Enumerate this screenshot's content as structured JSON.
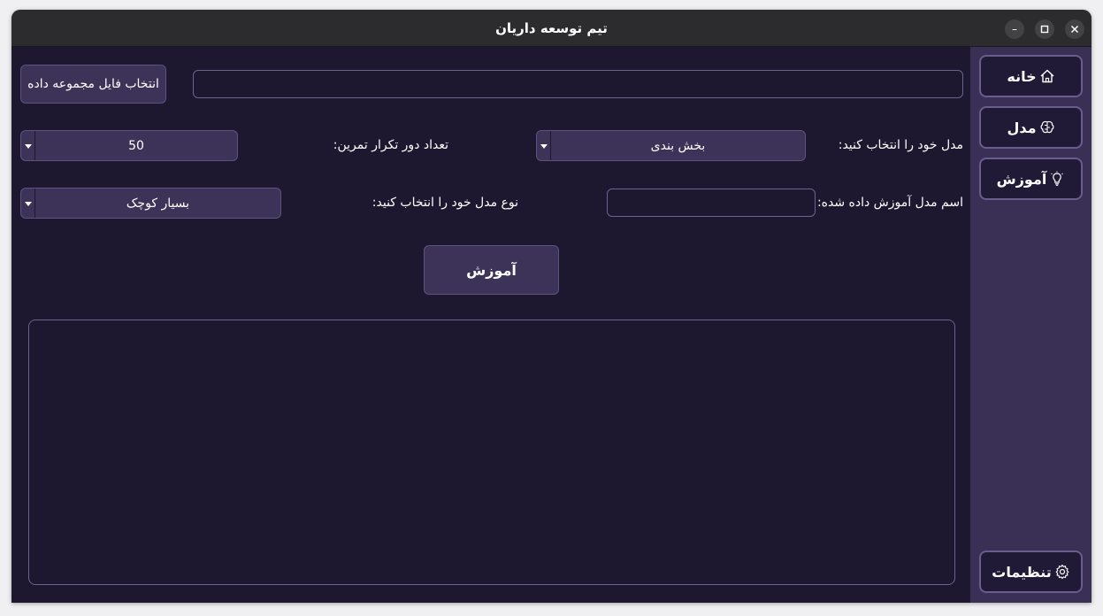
{
  "window": {
    "title": "تیم توسعه داریان",
    "controls": {
      "minimize": "–"
    }
  },
  "sidebar": {
    "items": [
      {
        "label": "خانه",
        "icon": "home-icon"
      },
      {
        "label": "مدل",
        "icon": "brain-icon"
      },
      {
        "label": "آموزش",
        "icon": "lightbulb-icon"
      }
    ],
    "settings": {
      "label": "تنظیمات",
      "icon": "gear-icon"
    }
  },
  "dataset": {
    "button_label": "انتخاب فایل مجموعه داده",
    "path_value": ""
  },
  "model_select": {
    "label": "مدل خود را انتخاب کنید:",
    "value": "بخش بندی"
  },
  "epochs": {
    "label": "تعداد دور تکرار تمرین:",
    "value": "50"
  },
  "trained_name": {
    "label": "اسم مدل آموزش داده شده:",
    "value": ""
  },
  "model_type": {
    "label": "نوع مدل خود را انتخاب کنید:",
    "value": "بسیار کوچک"
  },
  "train_button": {
    "label": "آموزش"
  },
  "log": {
    "text": ""
  },
  "colors": {
    "background": "#1d1730",
    "sidebar": "#3a2f55",
    "button": "#3d3258",
    "border": "#6d6390"
  }
}
